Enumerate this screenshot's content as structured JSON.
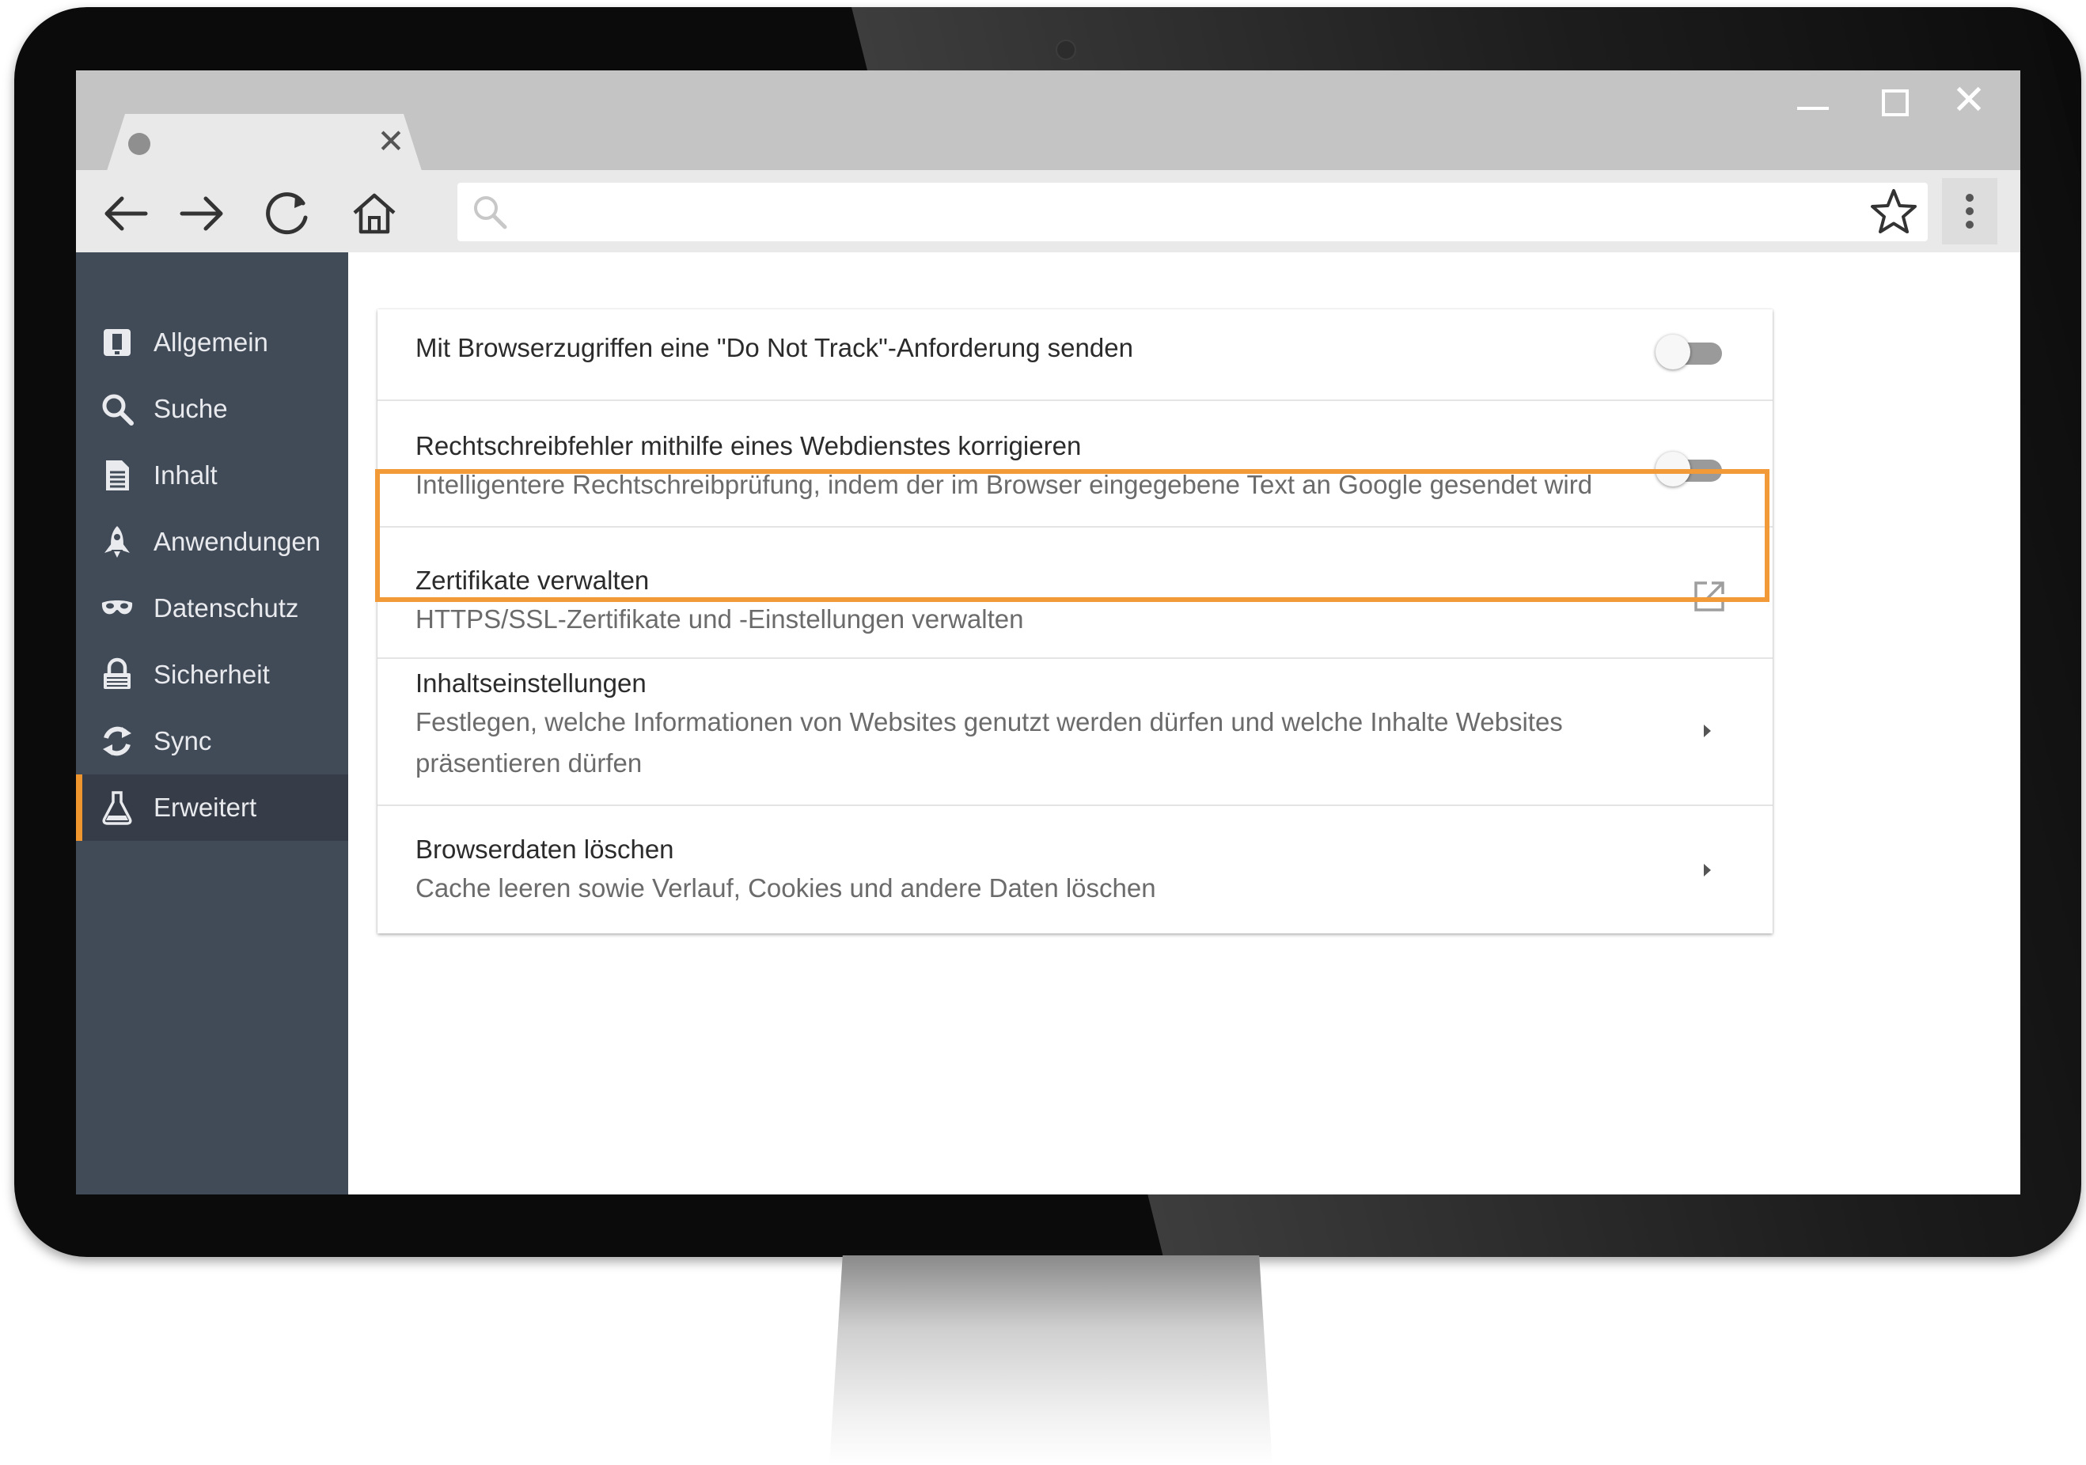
{
  "browser": {
    "tab": {
      "title": "",
      "close_icon": "close-icon",
      "favicon": "favicon-placeholder"
    },
    "window_controls": [
      "minimize-icon",
      "maximize-icon",
      "close-icon"
    ],
    "nav_icons": [
      "back-arrow-icon",
      "forward-arrow-icon",
      "reload-icon",
      "home-icon"
    ],
    "omnibox": {
      "value": "",
      "placeholder": "",
      "icon": "search-icon",
      "bookmark_icon": "star-icon"
    },
    "menu_icon": "kebab-menu-icon"
  },
  "sidebar": {
    "accent_color": "#f0962e",
    "background_color": "#414a57",
    "active_item": "Erweitert",
    "items": [
      {
        "label": "Allgemein",
        "icon": "general-icon"
      },
      {
        "label": "Suche",
        "icon": "search-icon"
      },
      {
        "label": "Inhalt",
        "icon": "document-icon"
      },
      {
        "label": "Anwendungen",
        "icon": "rocket-icon"
      },
      {
        "label": "Datenschutz",
        "icon": "mask-icon"
      },
      {
        "label": "Sicherheit",
        "icon": "lock-icon"
      },
      {
        "label": "Sync",
        "icon": "sync-icon"
      },
      {
        "label": "Erweitert",
        "icon": "flask-icon"
      }
    ]
  },
  "settings": {
    "highlight_color": "#f29a38",
    "rows": [
      {
        "title": "Mit Browserzugriffen eine \"Do Not Track\"-Anforderung senden",
        "subtitle": "",
        "control": "toggle",
        "enabled": false
      },
      {
        "title": "Rechtschreibfehler mithilfe eines Webdienstes korrigieren",
        "subtitle": "Intelligentere Rechtschreibprüfung, indem der im Browser eingegebene Text an Google gesendet wird",
        "control": "toggle",
        "enabled": false
      },
      {
        "title": "Zertifikate verwalten",
        "subtitle": "HTTPS/SSL-Zertifikate und -Einstellungen verwalten",
        "control": "external-link-icon",
        "highlighted": true
      },
      {
        "title": "Inhaltseinstellungen",
        "subtitle": "Festlegen, welche Informationen von Websites genutzt werden dürfen und welche Inhalte Websites präsentieren dürfen",
        "control": "chevron-right-icon"
      },
      {
        "title": "Browserdaten löschen",
        "subtitle": "Cache leeren sowie Verlauf, Cookies und andere Daten löschen",
        "control": "chevron-right-icon"
      }
    ]
  }
}
